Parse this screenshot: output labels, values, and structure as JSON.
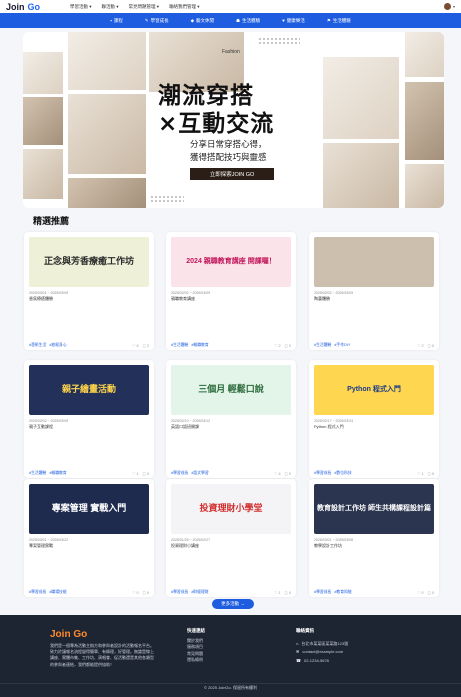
{
  "header": {
    "logo_main": "Join",
    "logo_accent": "Go",
    "nav": [
      "學習活動 ▾",
      "聯活動 ▾",
      "常見問題管理 ▾",
      "聯絡我們管理 ▾"
    ]
  },
  "categories": [
    {
      "icon": "▪",
      "label": "課程"
    },
    {
      "icon": "✎",
      "label": "學習成長"
    },
    {
      "icon": "◆",
      "label": "藝文休閒"
    },
    {
      "icon": "☗",
      "label": "生活體驗"
    },
    {
      "icon": "♥",
      "label": "健康樂活"
    },
    {
      "icon": "⚑",
      "label": "生活體驗"
    }
  ],
  "banner": {
    "label": "Fashion",
    "title_line1": "潮流穿搭",
    "title_line2": "×互動交流",
    "subtitle_line1": "分享日常穿搭心得，",
    "subtitle_line2": "獲得搭配技巧與靈感",
    "cta": "立即探索JOIN GO"
  },
  "section": {
    "title": "精選推薦"
  },
  "cards": [
    {
      "thumb_text": "正念與芳香療癒工作坊",
      "thumb_bg": "#eef0d8",
      "thumb_color": "#2a2a2a",
      "date": "2025/03/01 ~ 2025/03/09",
      "title": "香氛療癒體驗",
      "tags": [
        "#藝術生活",
        "#放鬆身心"
      ],
      "likes": "6",
      "comments": "2"
    },
    {
      "thumb_text": "2024 親職教育講座 開課囉！",
      "thumb_bg": "#fbe3ea",
      "thumb_color": "#c2185b",
      "date": "2025/02/02 ~ 2025/03/09",
      "title": "親職教育講座",
      "tags": [
        "#生活體驗",
        "#親職教育"
      ],
      "likes": "2",
      "comments": "0"
    },
    {
      "thumb_text": "",
      "thumb_bg": "#cdbfae",
      "thumb_color": "#333",
      "date": "2025/02/02 ~ 2025/03/09",
      "title": "陶藝體驗",
      "tags": [
        "#生活體驗",
        "#手作DIY"
      ],
      "likes": "2",
      "comments": "0"
    },
    {
      "thumb_text": "親子繪畫活動",
      "thumb_bg": "#22305a",
      "thumb_color": "#ffd54a",
      "date": "2025/02/02 ~ 2025/03/09",
      "title": "親子互動課程",
      "tags": [
        "#生活體驗",
        "#親職教育"
      ],
      "likes": "1",
      "comments": "0"
    },
    {
      "thumb_text": "三個月 輕鬆口說",
      "thumb_bg": "#e3f4e8",
      "thumb_color": "#2a6a3a",
      "date": "2025/02/10 ~ 2025/03/12",
      "title": "英語口語班開課",
      "tags": [
        "#學習成長",
        "#語文學習"
      ],
      "likes": "4",
      "comments": "0"
    },
    {
      "thumb_text": "Python 程式入門",
      "thumb_bg": "#ffd64f",
      "thumb_color": "#1b3a8a",
      "date": "2025/02/17 ~ 2025/03/24",
      "title": "Python 程式入門",
      "tags": [
        "#學習成長",
        "#數位科技"
      ],
      "likes": "1",
      "comments": "0"
    },
    {
      "thumb_text": "專案管理 實戰入門",
      "thumb_bg": "#1f2a4f",
      "thumb_color": "#ffffff",
      "date": "2025/03/01 ~ 2025/03/22",
      "title": "專案管理實戰",
      "tags": [
        "#學習成長",
        "#職場技能"
      ],
      "likes": "0",
      "comments": "0"
    },
    {
      "thumb_text": "投資理財小學堂",
      "thumb_bg": "#f4f4f7",
      "thumb_color": "#d32f2f",
      "date": "2025/01/25 ~ 2025/02/27",
      "title": "投資理財小講座",
      "tags": [
        "#學習成長",
        "#財經理財"
      ],
      "likes": "1",
      "comments": "0"
    },
    {
      "thumb_text": "教育設計工作坊 師生共構課程設計篇",
      "thumb_bg": "#2b3550",
      "thumb_color": "#ffffff",
      "date": "2025/03/01 ~ 2025/03/08",
      "title": "教學設計工作坊",
      "tags": [
        "#學習成長",
        "#教育知能"
      ],
      "likes": "0",
      "comments": "0"
    }
  ],
  "more_button": "更多活動 →",
  "footer": {
    "logo_main": "Join",
    "logo_accent": "Go",
    "description": "我們是一個專為活動主辦方和參與者設計的活動報名平台。致力於讓報名流程變得簡單、有條理，好管理。無論是線上講座、實體市集、工作坊、演唱會、促活動還是其他各類型的參與者連結，我們都能提供協助！",
    "quick_title": "快速連結",
    "quick_links": [
      "關於我們",
      "服務項目",
      "常見問題",
      "隱私條例"
    ],
    "contact_title": "聯絡資訊",
    "contact": [
      {
        "icon": "⌂",
        "text": "台北市某某區某某路123號"
      },
      {
        "icon": "✉",
        "text": "contact@example.com"
      },
      {
        "icon": "☎",
        "text": "02-1234-5678"
      }
    ],
    "copyright": "© 2025 JoinGo. 保留所有權利"
  }
}
